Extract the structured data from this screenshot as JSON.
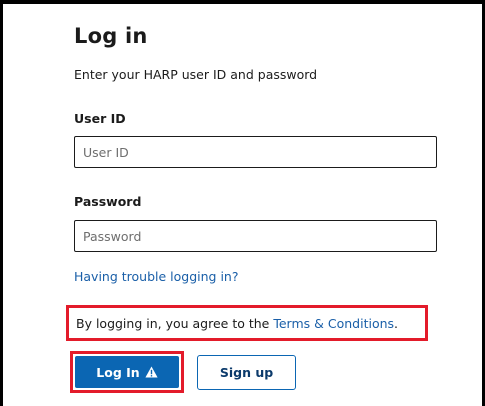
{
  "login": {
    "title": "Log in",
    "subtitle": "Enter your HARP user ID and password",
    "user_id": {
      "label": "User ID",
      "placeholder": "User ID",
      "value": ""
    },
    "password": {
      "label": "Password",
      "placeholder": "Password",
      "value": ""
    },
    "trouble_link": "Having trouble logging in?",
    "agreement": {
      "text": "By logging in, you agree to the ",
      "link": "Terms & Conditions",
      "suffix": "."
    },
    "buttons": {
      "login_label": "Log In",
      "login_icon": "warning-icon",
      "signup_label": "Sign up"
    }
  },
  "colors": {
    "primary": "#0b66b3",
    "link": "#1a5fa8",
    "highlight": "#e31b2a",
    "text": "#1b1b1b"
  }
}
